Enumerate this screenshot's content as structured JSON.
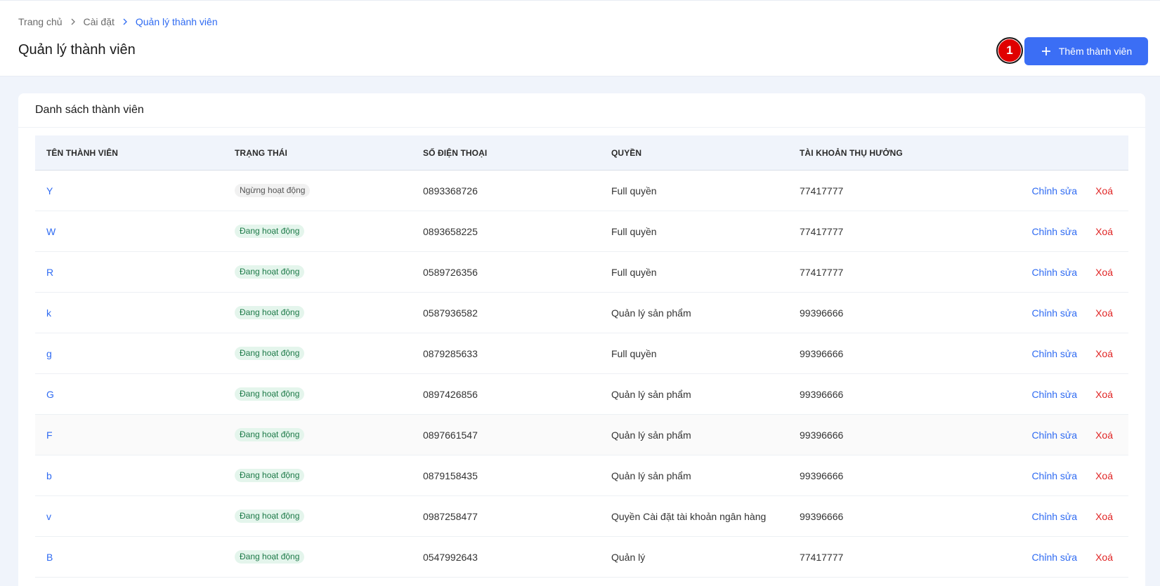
{
  "breadcrumb": {
    "home": "Trang chủ",
    "settings": "Cài đặt",
    "current": "Quản lý thành viên"
  },
  "page_title": "Quản lý thành viên",
  "step_badge": "1",
  "add_button_label": "Thêm thành viên",
  "card_title": "Danh sách thành viên",
  "columns": [
    "TÊN THÀNH VIÊN",
    "TRẠNG THÁI",
    "SỐ ĐIỆN THOẠI",
    "QUYỀN",
    "TÀI KHOẢN THỤ HƯỞNG"
  ],
  "actions": {
    "edit": "Chỉnh sửa",
    "delete": "Xoá"
  },
  "rows": [
    {
      "name": "Y",
      "status": "Ngừng hoạt động",
      "phone": "0893368726",
      "role": "Full quyền",
      "account": "77417777"
    },
    {
      "name": "W",
      "status": "Đang hoạt động",
      "phone": "0893658225",
      "role": "Full quyền",
      "account": "77417777"
    },
    {
      "name": "R",
      "status": "Đang hoạt động",
      "phone": "0589726356",
      "role": "Full quyền",
      "account": "77417777"
    },
    {
      "name": "k",
      "status": "Đang hoạt động",
      "phone": "0587936582",
      "role": "Quản lý sản phẩm",
      "account": "99396666"
    },
    {
      "name": "g",
      "status": "Đang hoạt động",
      "phone": "0879285633",
      "role": "Full quyền",
      "account": "99396666"
    },
    {
      "name": "G",
      "status": "Đang hoạt động",
      "phone": "0897426856",
      "role": "Quản lý sản phẩm",
      "account": "99396666"
    },
    {
      "name": "F",
      "status": "Đang hoạt động",
      "phone": "0897661547",
      "role": "Quản lý sản phẩm",
      "account": "99396666"
    },
    {
      "name": "b",
      "status": "Đang hoạt động",
      "phone": "0879158435",
      "role": "Quản lý sản phẩm",
      "account": "99396666"
    },
    {
      "name": "v",
      "status": "Đang hoạt động",
      "phone": "0987258477",
      "role": "Quyền Cài đặt tài khoản ngân hàng",
      "account": "99396666"
    },
    {
      "name": "B",
      "status": "Đang hoạt động",
      "phone": "0547992643",
      "role": "Quản lý",
      "account": "77417777"
    }
  ],
  "colors": {
    "primary": "#3b6ef5",
    "link": "#2f6bf2",
    "danger": "#e02424",
    "active_bg": "#e4f5ec",
    "active_text": "#1d7a48"
  }
}
